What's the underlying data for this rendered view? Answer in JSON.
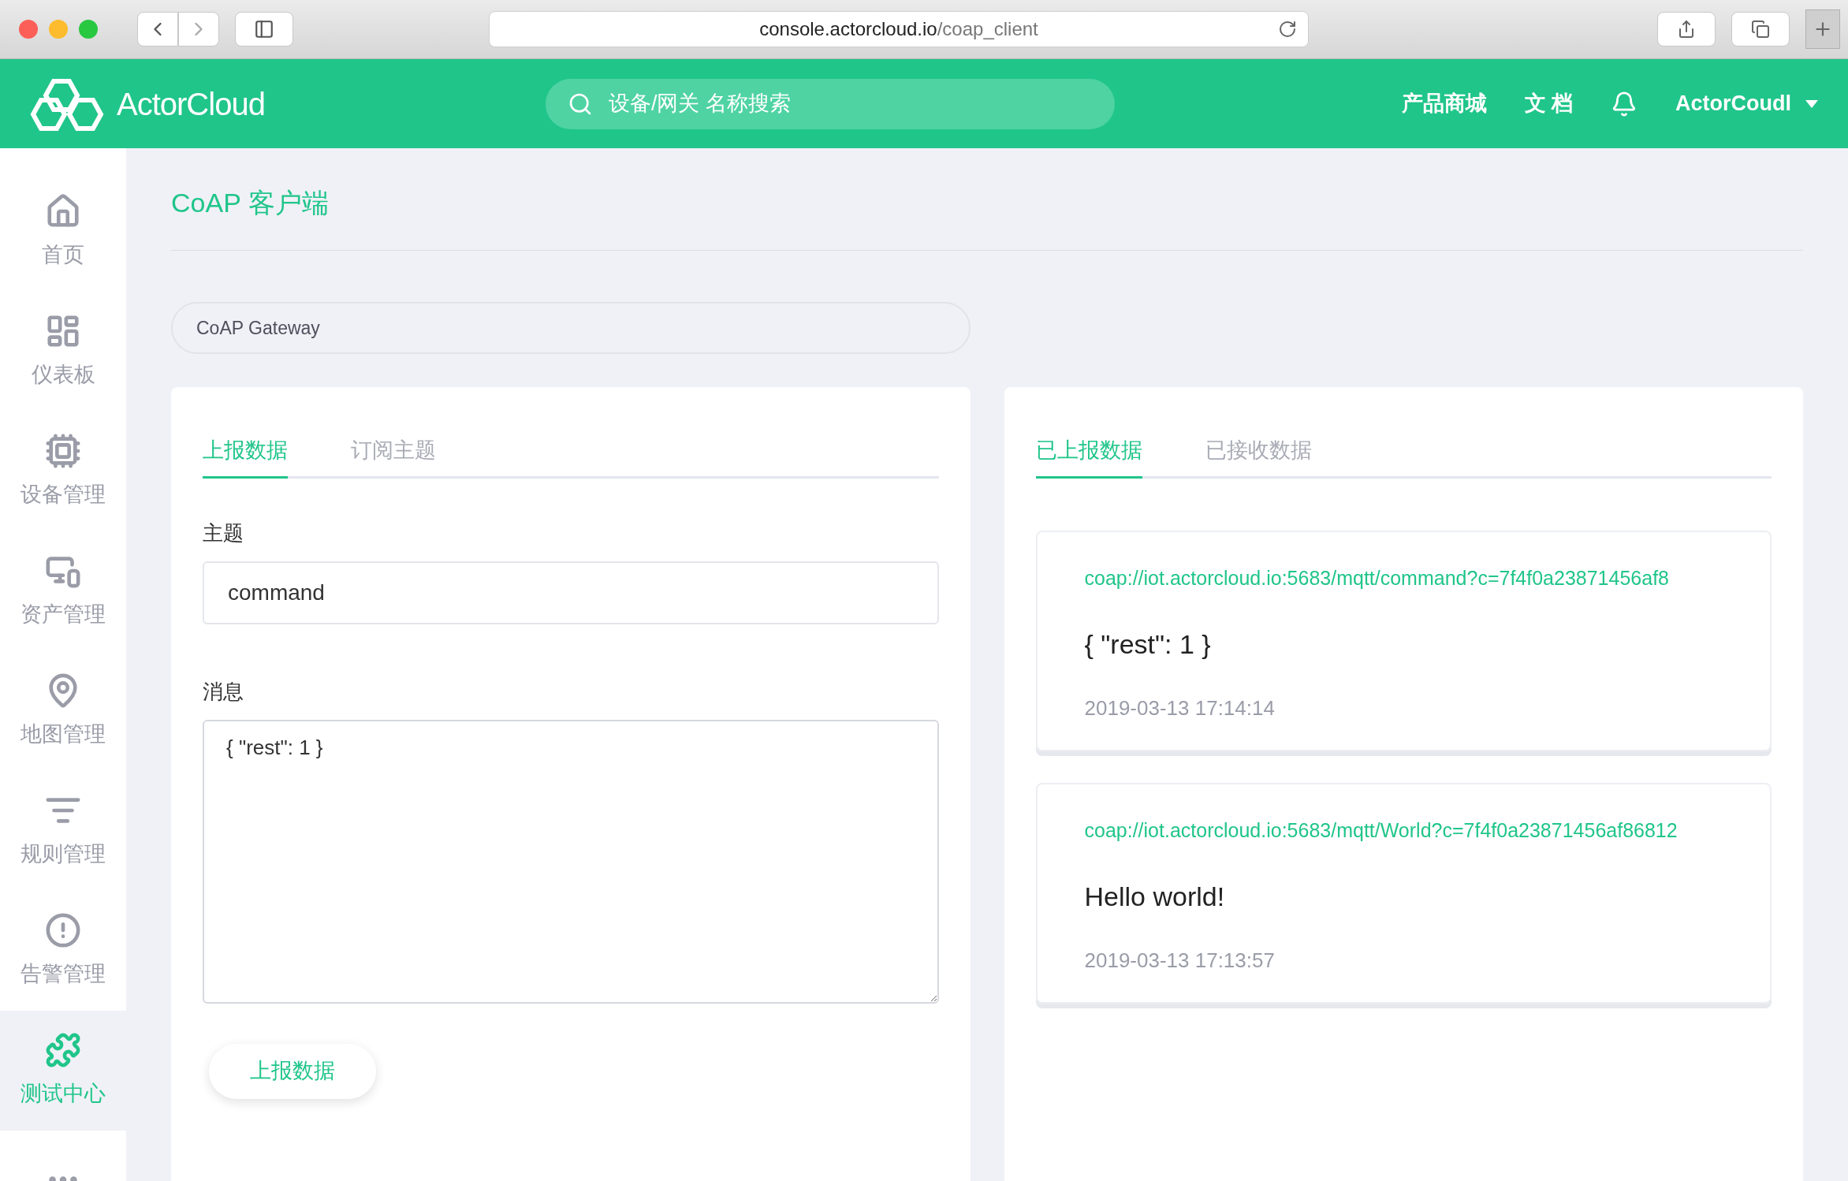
{
  "browser": {
    "url_host": "console.actorcloud.io",
    "url_path": "/coap_client"
  },
  "header": {
    "logo": "ActorCloud",
    "search": {
      "placeholder": "设备/网关 名称搜索"
    },
    "links": [
      "产品商城",
      "文 档"
    ],
    "user": "ActorCoudl"
  },
  "sidebar": {
    "items": [
      {
        "label": "首页",
        "selected": false
      },
      {
        "label": "仪表板",
        "selected": false
      },
      {
        "label": "设备管理",
        "selected": false
      },
      {
        "label": "资产管理",
        "selected": false
      },
      {
        "label": "地图管理",
        "selected": false
      },
      {
        "label": "规则管理",
        "selected": false
      },
      {
        "label": "告警管理",
        "selected": false
      },
      {
        "label": "测试中心",
        "selected": true
      },
      {
        "selected": false
      }
    ]
  },
  "page": {
    "title": "CoAP 客户端",
    "gateway": "CoAP Gateway"
  },
  "publish_panel": {
    "tabs": [
      {
        "label": "上报数据",
        "selected": true
      },
      {
        "label": "订阅主题",
        "selected": false
      }
    ],
    "topic": {
      "label": "主题",
      "value": "command"
    },
    "message": {
      "label": "消息",
      "value": "{ \"rest\": 1 }"
    },
    "submit": "上报数据"
  },
  "history_panel": {
    "tabs": [
      {
        "label": "已上报数据",
        "selected": true
      },
      {
        "label": "已接收数据",
        "selected": false
      }
    ],
    "records": [
      {
        "url": "coap://iot.actorcloud.io:5683/mqtt/command?c=7f4f0a23871456af8",
        "payload": "{ \"rest\": 1 }",
        "time": "2019-03-13 17:14:14"
      },
      {
        "url": "coap://iot.actorcloud.io:5683/mqtt/World?c=7f4f0a23871456af86812",
        "payload": "Hello world!",
        "time": "2019-03-13 17:13:57"
      }
    ]
  }
}
